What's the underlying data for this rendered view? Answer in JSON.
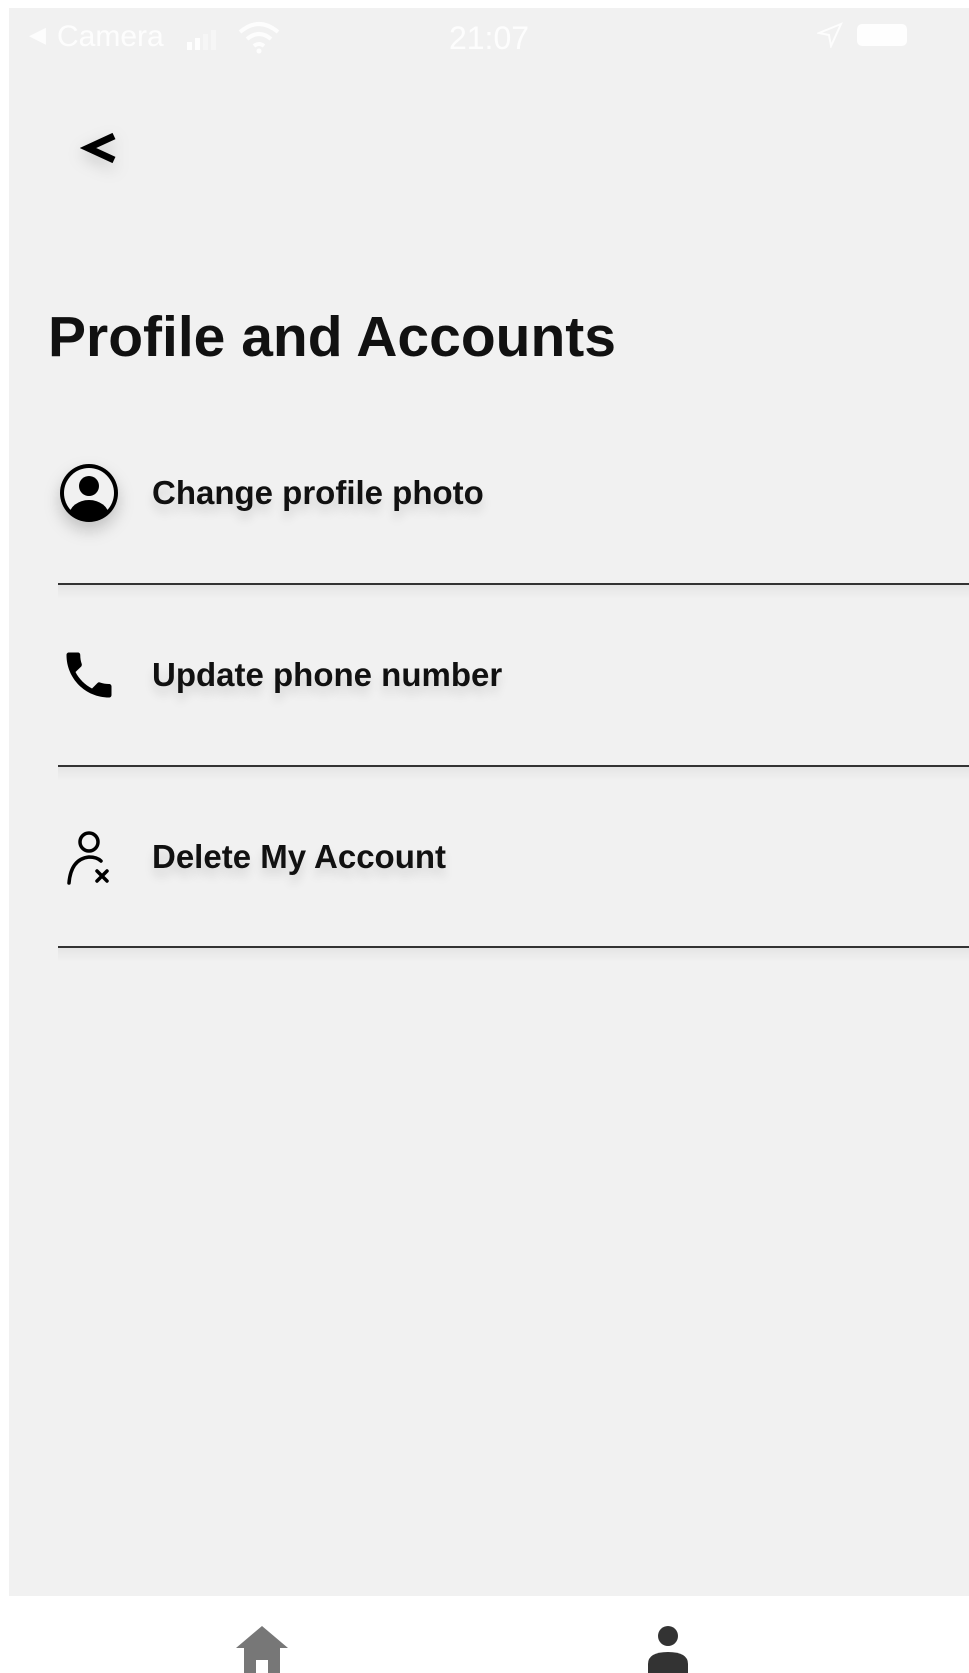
{
  "status_bar": {
    "back_glyph": "◀",
    "carrier": "Camera",
    "time": "21:07",
    "icons": [
      "signal-icon",
      "wifi-icon",
      "location-arrow-icon",
      "battery-icon"
    ]
  },
  "header": {
    "back_icon": "chevron-left-icon",
    "back_glyph": "<",
    "title": "Profile and Accounts"
  },
  "menu": {
    "items": [
      {
        "icon": "account-circle-icon",
        "label": "Change profile photo"
      },
      {
        "icon": "phone-icon",
        "label": "Update phone number"
      },
      {
        "icon": "person-remove-icon",
        "label": "Delete My Account"
      }
    ]
  },
  "bottom_nav": {
    "items": [
      {
        "icon": "home-icon",
        "color": "#777777"
      },
      {
        "icon": "person-icon",
        "color": "#333333"
      }
    ]
  },
  "colors": {
    "background": "#f1f1f1",
    "text": "#111111",
    "divider": "#333333"
  }
}
